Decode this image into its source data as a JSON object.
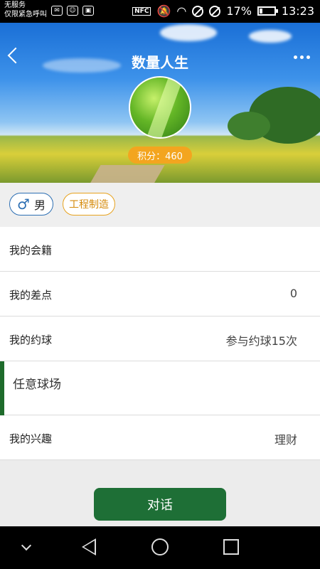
{
  "status_bar": {
    "carrier_line1": "无服务",
    "carrier_line2": "仅限紧急呼叫",
    "nfc": "NFC",
    "battery": "17%",
    "time": "13:23"
  },
  "header": {
    "title": "数量人生",
    "points": "积分：460"
  },
  "tags": {
    "gender_symbol": "♂",
    "gender": "男",
    "industry": "工程制造"
  },
  "rows": [
    {
      "label": "我的会籍",
      "value": ""
    },
    {
      "label": "我的差点",
      "value": "0"
    },
    {
      "label": "我的约球",
      "value": "参与约球15次"
    },
    {
      "label": "任意球场",
      "value": ""
    },
    {
      "label": "我的兴趣",
      "value": "理财"
    }
  ],
  "actions": {
    "chat": "对话"
  },
  "colors": {
    "accent_green": "#1e6f36",
    "points_orange": "#f3a51f",
    "gender_blue": "#2d6fb3",
    "industry_orange": "#e7a21e"
  },
  "icons": {
    "back": "chevron-left-icon",
    "more": "more-dots-icon",
    "gender": "male-icon"
  }
}
